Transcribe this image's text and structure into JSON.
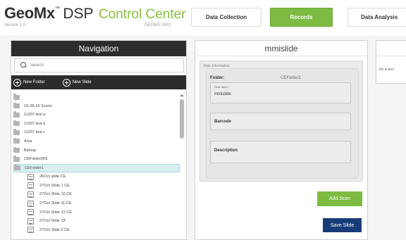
{
  "header": {
    "brand_geo": "GeoMx",
    "brand_tm": "™",
    "brand_dsp": "DSP",
    "brand_cc": "Control Center",
    "version": "Version 1.0",
    "instrument": "GEOMX-0001",
    "tabs": [
      {
        "label": "Data Collection",
        "active": false
      },
      {
        "label": "Records",
        "active": true
      },
      {
        "label": "Data Analysis",
        "active": false
      }
    ]
  },
  "navigation": {
    "title": "Navigation",
    "search_placeholder": "Search",
    "new_folder_label": "New Folder",
    "new_slide_label": "New Slide",
    "tree": [
      {
        "label": "",
        "type": "folder",
        "selected": false
      },
      {
        "label": "10-28-18 Scans",
        "type": "folder",
        "selected": false
      },
      {
        "label": "11207 test a",
        "type": "folder",
        "selected": false
      },
      {
        "label": "11207 test b",
        "type": "folder",
        "selected": false
      },
      {
        "label": "11207 test c",
        "type": "folder",
        "selected": false
      },
      {
        "label": "Arya",
        "type": "folder",
        "selected": false
      },
      {
        "label": "Bishop",
        "type": "folder",
        "selected": false
      },
      {
        "label": "CBFolder05S",
        "type": "folder",
        "selected": false
      },
      {
        "label": "CEFolder1",
        "type": "folder",
        "selected": true
      },
      {
        "label": "26Oct slide CE",
        "type": "slide",
        "selected": false
      },
      {
        "label": "27Oct Slide 1 CE",
        "type": "slide",
        "selected": false
      },
      {
        "label": "27Oct Slide 10 CE",
        "type": "slide",
        "selected": false
      },
      {
        "label": "27Oct Slide 11 CE",
        "type": "slide",
        "selected": false
      },
      {
        "label": "27Oct Slide 12 CE",
        "type": "slide",
        "selected": false
      },
      {
        "label": "27Oct Slide 13",
        "type": "slide",
        "selected": false
      },
      {
        "label": "27Oct Slide 2 CE",
        "type": "slide",
        "selected": false
      }
    ]
  },
  "slide": {
    "title": "mmislide",
    "info_label": "Slide Information",
    "folder_key": "Folder:",
    "folder_value": "CEFolder1",
    "slide_label_caption": "Slide label *",
    "slide_label_value": "mmislide",
    "barcode_label": "Barcode",
    "description_label": "Description",
    "add_scan_label": "Add Scan",
    "save_slide_label": "Save Slide"
  },
  "scans_panel": {
    "empty_text": "No scans"
  },
  "colors": {
    "accent_green": "#7dbb42",
    "dark_header": "#2c2c2c",
    "save_blue": "#163d78",
    "selected_row": "#d8eff2"
  }
}
